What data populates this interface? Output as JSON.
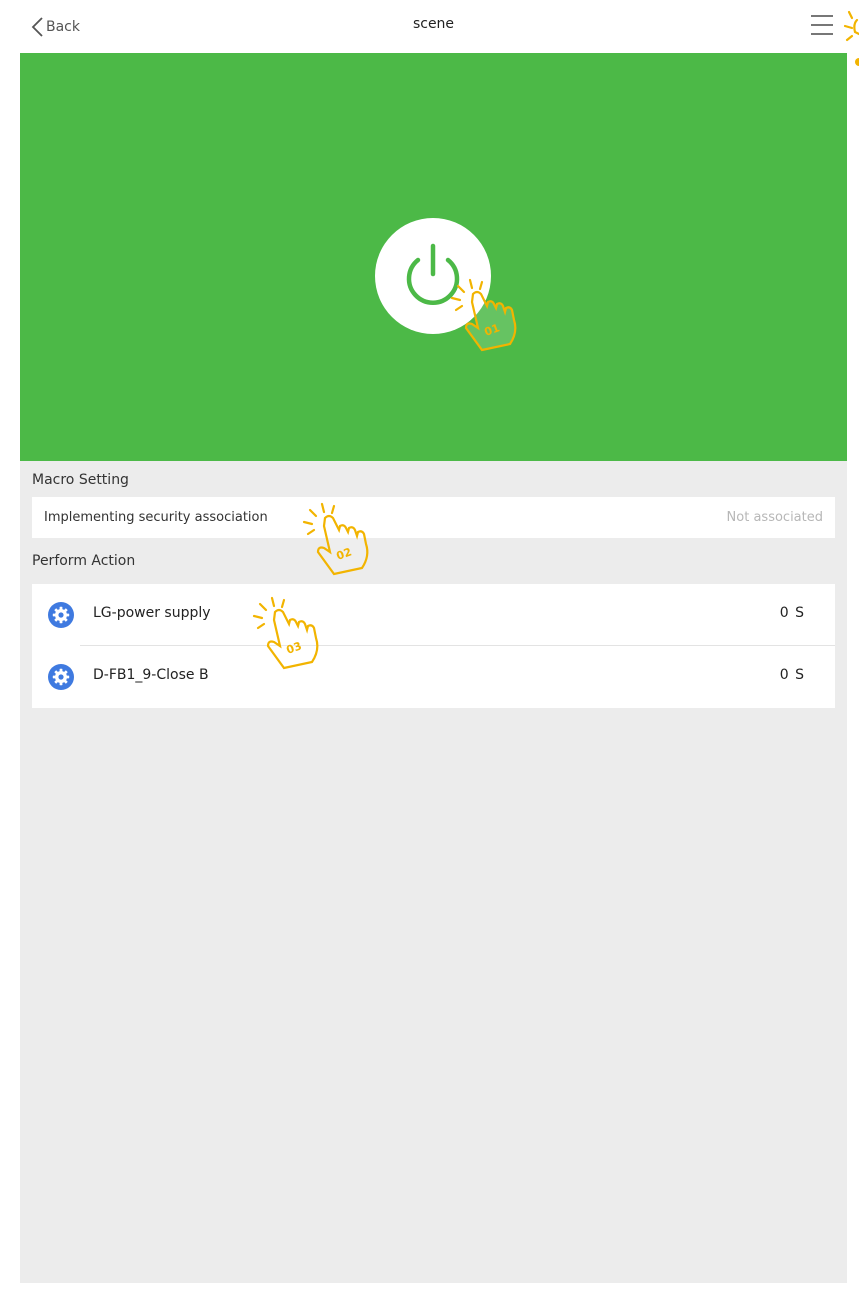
{
  "nav": {
    "back_label": "Back",
    "title": "scene"
  },
  "macro": {
    "section_label": "Macro Setting",
    "security_label": "Implementing security association",
    "security_value": "Not associated"
  },
  "actions": {
    "section_label": "Perform Action",
    "items": [
      {
        "name": "LG-power supply",
        "time": "0 S"
      },
      {
        "name": "D-FB1_9-Close B",
        "time": "0 S"
      }
    ]
  },
  "markers": [
    "01",
    "02",
    "03"
  ],
  "colors": {
    "hero": "#4cb947",
    "accent_icon": "#3f7ae0",
    "marker": "#f2b400",
    "background": "#ececec"
  }
}
